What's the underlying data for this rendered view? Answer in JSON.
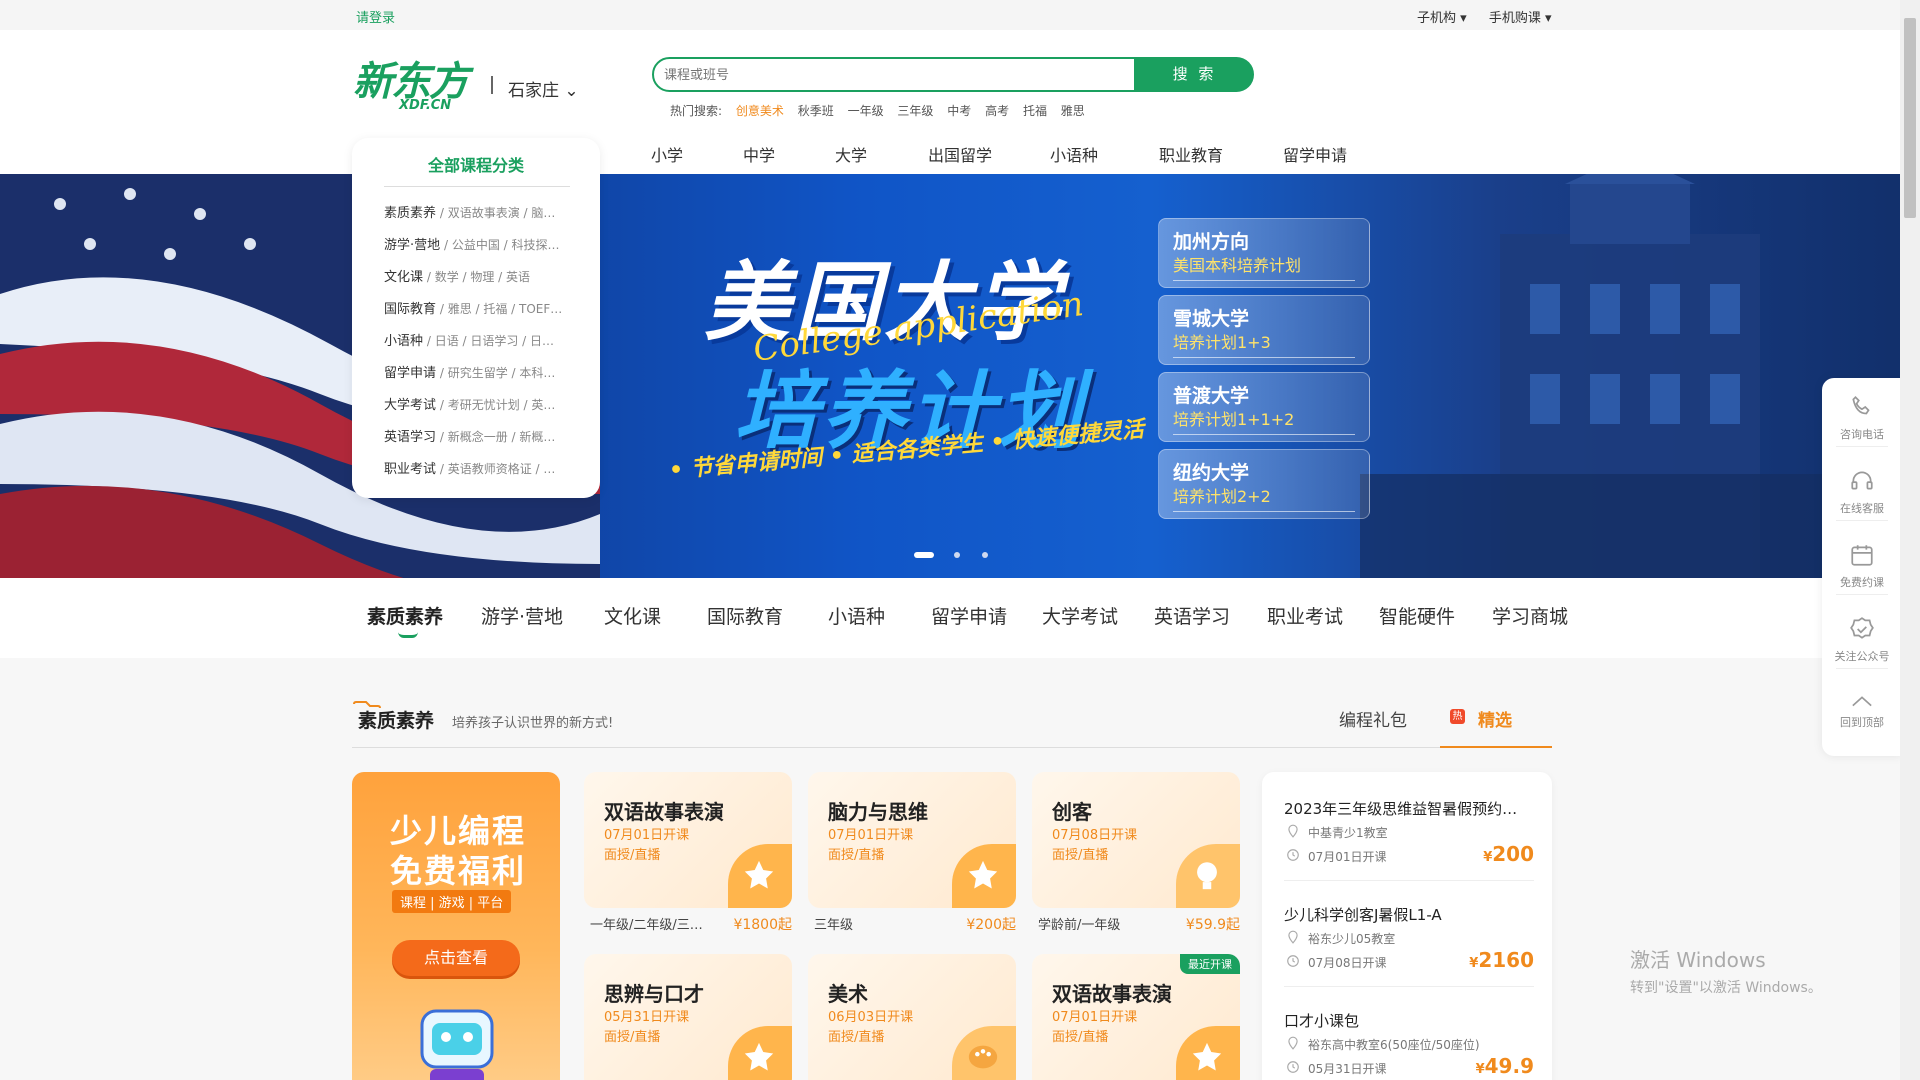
{
  "topbar": {
    "login": "请登录",
    "sub_org": "子机构 ▾",
    "mobile": "手机购课 ▾"
  },
  "logo": {
    "text": "新东方",
    "sub": "XDF.CN"
  },
  "city": "石家庄 ⌄",
  "search": {
    "placeholder": "课程或班号",
    "button": "搜 索"
  },
  "hot": {
    "label": "热门搜索:",
    "items": [
      "创意美术",
      "秋季班",
      "一年级",
      "三年级",
      "中考",
      "高考",
      "托福",
      "雅思"
    ]
  },
  "mainnav": [
    "小学",
    "中学",
    "大学",
    "出国留学",
    "小语种",
    "职业教育",
    "留学申请"
  ],
  "category": {
    "title": "全部课程分类",
    "rows": [
      {
        "name": "素质素养",
        "sub": " / 双语故事表演 / 脑…"
      },
      {
        "name": "游学·营地",
        "sub": " / 公益中国 / 科技探…"
      },
      {
        "name": "文化课",
        "sub": " / 数学 / 物理 / 英语"
      },
      {
        "name": "国际教育",
        "sub": " / 雅思 / 托福 / TOEF…"
      },
      {
        "name": "小语种",
        "sub": " / 日语 / 日语学习 / 日…"
      },
      {
        "name": "留学申请",
        "sub": " / 研究生留学 / 本科…"
      },
      {
        "name": "大学考试",
        "sub": " / 考研无忧计划 / 英…"
      },
      {
        "name": "英语学习",
        "sub": " / 新概念一册 / 新概…"
      },
      {
        "name": "职业考试",
        "sub": " / 英语教师资格证 / …"
      }
    ]
  },
  "banner": {
    "title": "美国大学",
    "cursive": "College application",
    "subtitle": "培养计划",
    "tagline": "• 节省申请时间 • 适合各类学生 • 快速便捷灵活",
    "plans": [
      {
        "a": "加州方向",
        "b": "美国本科培养计划"
      },
      {
        "a": "雪城大学",
        "b": "培养计划1+3"
      },
      {
        "a": "普渡大学",
        "b": "培养计划1+1+2"
      },
      {
        "a": "纽约大学",
        "b": "培养计划2+2"
      }
    ]
  },
  "tabs": [
    "素质素养",
    "游学·营地",
    "文化课",
    "国际教育",
    "小语种",
    "留学申请",
    "大学考试",
    "英语学习",
    "职业考试",
    "智能硬件",
    "学习商城"
  ],
  "section": {
    "title": "素质素养",
    "desc": "培养孩子认识世界的新方式!",
    "tab1": "编程礼包",
    "hot_badge": "热",
    "tab2": "精选"
  },
  "promo": {
    "line1": "少儿编程",
    "line2": "免费福利",
    "tags": "课程 | 游戏 | 平台",
    "button": "点击查看"
  },
  "cards": [
    {
      "name": "双语故事表演",
      "date": "07月01日开课",
      "mode": "面授/直播",
      "grade": "一年级/二年级/三…",
      "price": "¥1800起"
    },
    {
      "name": "脑力与思维",
      "date": "07月01日开课",
      "mode": "面授/直播",
      "grade": "三年级",
      "price": "¥200起"
    },
    {
      "name": "创客",
      "date": "07月08日开课",
      "mode": "面授/直播",
      "grade": "学龄前/一年级",
      "price": "¥59.9起"
    },
    {
      "name": "思辨与口才",
      "date": "05月31日开课",
      "mode": "面授/直播",
      "grade": "",
      "price": ""
    },
    {
      "name": "美术",
      "date": "06月03日开课",
      "mode": "面授/直播",
      "grade": "",
      "price": ""
    },
    {
      "name": "双语故事表演",
      "date": "07月01日开课",
      "mode": "面授/直播",
      "grade": "",
      "price": "",
      "badge": "最近开课"
    }
  ],
  "list": [
    {
      "title": "2023年三年级思维益智暑假预约…",
      "place": "中基青少1教室",
      "date": "07月01日开课",
      "price": "200"
    },
    {
      "title": "少儿科学创客J暑假L1-A",
      "place": "裕东少儿05教室",
      "date": "07月08日开课",
      "price": "2160"
    },
    {
      "title": "口才小课包",
      "place": "裕东高中教室6(50座位/50座位)",
      "date": "05月31日开课",
      "price": "49.9"
    }
  ],
  "currency": "¥",
  "side": [
    "咨询电话",
    "在线客服",
    "免费约课",
    "关注公众号",
    "回到顶部"
  ],
  "watermark": {
    "a": "激活 Windows",
    "b": "转到\"设置\"以激活 Windows。"
  }
}
